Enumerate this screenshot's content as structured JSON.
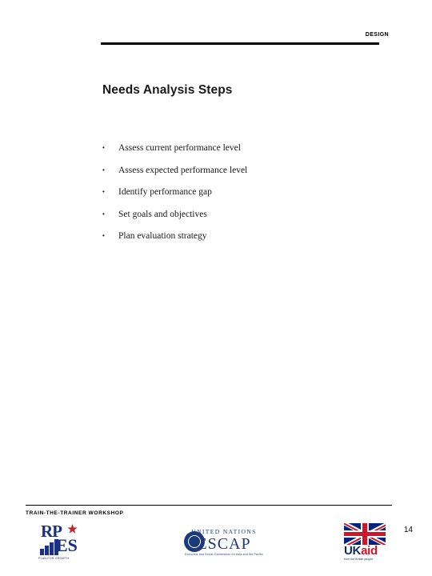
{
  "header": {
    "section_label": "DESIGN"
  },
  "title": "Needs Analysis Steps",
  "bullets": [
    {
      "marker": "•",
      "text": "Assess current performance level"
    },
    {
      "marker": "•",
      "text": "Assess expected performance level"
    },
    {
      "marker": "•",
      "text": "Identify performance gap"
    },
    {
      "marker": "•",
      "text": "Set goals and objectives"
    },
    {
      "marker": "•",
      "text": "Plan evaluation strategy"
    }
  ],
  "footer": {
    "workshop_label": "TRAIN-THE-TRAINER WORKSHOP",
    "page_number": "14"
  },
  "logos": {
    "rpes": {
      "letters_rp": "RP",
      "letters_es": "ES",
      "caption": "PLAN FOR GROWTH"
    },
    "escap": {
      "line1": "UNITED NATIONS",
      "line2": "ESCAP",
      "line3": "Economic and Social Commission for Asia and the Pacific"
    },
    "ukaid": {
      "uk": "UK",
      "aid": "aid",
      "strapline": "from the British people"
    }
  },
  "colors": {
    "rule": "#000000",
    "title": "#1a1a1a",
    "rpes_blue": "#1c2f80",
    "rpes_red": "#c0272d",
    "escap_blue": "#1b3a7a",
    "uk_blue": "#00247d",
    "uk_red": "#cf142b"
  }
}
